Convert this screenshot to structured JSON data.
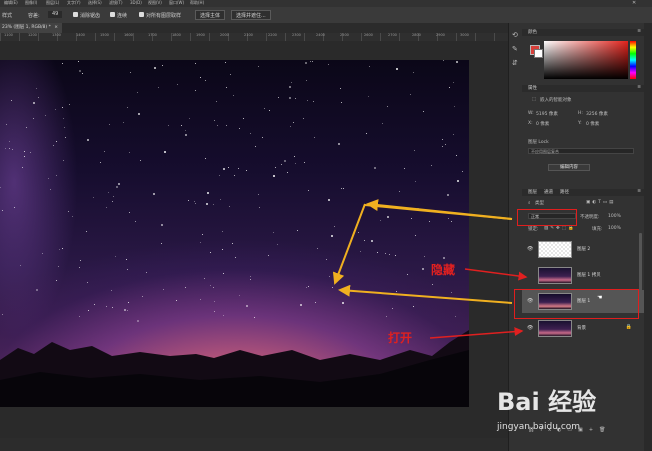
{
  "menubar": {
    "items": [
      "编辑(E)",
      "图像(I)",
      "图层(L)",
      "文字(Y)",
      "选择(S)",
      "滤镜(T)",
      "3D(D)",
      "视图(V)",
      "窗口(W)",
      "帮助(H)"
    ]
  },
  "options_bar": {
    "mode_label": "样式",
    "feather_label": "容差:",
    "feather_value": "49",
    "antialias_label": "消除锯齿",
    "contiguous_label": "连续",
    "sample_all_label": "对所有图层取样",
    "select_subject_label": "选择主体",
    "select_mask_label": "选择并遮住..."
  },
  "document_tab": {
    "title": "23% (图层 1, RGB/8) *",
    "close": "×"
  },
  "ruler_labels": [
    "1100",
    "1200",
    "1300",
    "1400",
    "1500",
    "1600",
    "1700",
    "1800",
    "1900",
    "2000",
    "2100",
    "2200",
    "2300",
    "2400",
    "2500",
    "2600",
    "2700",
    "2800",
    "2900",
    "3000"
  ],
  "color_panel": {
    "title": "颜色",
    "fg_color": "#d8403a",
    "bg_color": "#ffffff"
  },
  "properties_panel": {
    "title": "属性",
    "subtitle": "嵌入的智能对象",
    "w_label": "W:",
    "w_value": "5195 像素",
    "h_label": "H:",
    "h_value": "3256 像素",
    "x_label": "X:",
    "x_value": "0 像素",
    "y_label": "Y:",
    "y_value": "0 像素",
    "layer_comp_label": "图层 Lock",
    "layer_comp_field": "不应用图层复合",
    "button": "编辑内容"
  },
  "layers_panel": {
    "tabs": [
      "图层",
      "通道",
      "路径"
    ],
    "kind_label": "类型",
    "blend_mode": "正常",
    "opacity_label": "不透明度:",
    "opacity_value": "100%",
    "lock_label": "锁定:",
    "fill_label": "填充:",
    "fill_value": "100%",
    "layers": [
      {
        "name": "图层 2",
        "visible": true,
        "selected": false,
        "thumb": "transparent"
      },
      {
        "name": "图层 1 拷贝",
        "visible": false,
        "selected": false,
        "thumb": "starry"
      },
      {
        "name": "图层 1",
        "visible": true,
        "selected": true,
        "thumb": "starry"
      },
      {
        "name": "背景",
        "visible": true,
        "selected": false,
        "thumb": "starry",
        "locked": true
      }
    ]
  },
  "annotations": {
    "hide": "隐藏",
    "open": "打开",
    "color": "#e02020",
    "arrow_color": "#f0b020"
  },
  "watermark": {
    "main": "Bai 经验",
    "url": "jingyan.baidu.com"
  }
}
